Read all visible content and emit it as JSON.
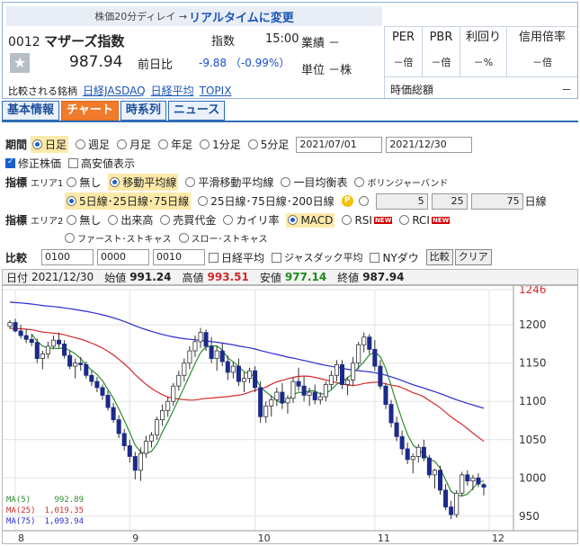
{
  "header": {
    "delay_text": "株価20分ディレイ →",
    "realtime_link": "リアルタイムに変更",
    "code": "0012",
    "name": "マザーズ指数",
    "kind": "指数",
    "time": "15:00",
    "price": "987.94",
    "prev_label": "前日比",
    "change": "-9.88 （-0.99%）",
    "compare_label": "比較される銘柄",
    "compare_links": [
      "日経JASDAQ",
      "日経平均",
      "TOPIX"
    ],
    "industry": "業績 －",
    "unit": "単位 －株",
    "metrics": [
      {
        "label": "PER",
        "value": "－倍"
      },
      {
        "label": "PBR",
        "value": "－倍"
      },
      {
        "label": "利回り",
        "value": "－%"
      },
      {
        "label": "信用倍率",
        "value": "－倍"
      }
    ],
    "market_cap_label": "時価総額",
    "market_cap_value": "－"
  },
  "tabs": [
    "基本情報",
    "チャート",
    "時系列",
    "ニュース"
  ],
  "controls": {
    "period_label": "期間",
    "period_options": [
      "日足",
      "週足",
      "月足",
      "年足",
      "1分足",
      "5分足"
    ],
    "date_from": "2021/07/01",
    "date_to": "2021/12/30",
    "adjusted_label": "修正株価",
    "highlow_label": "高安値表示",
    "indicator_label": "指標",
    "area1_label": "エリア1",
    "area1_options": [
      "無し",
      "移動平均線",
      "平滑移動平均線",
      "一目均衡表",
      "ボリンジャーバンド"
    ],
    "ma_option_a": "5日線･25日線･75日線",
    "ma_option_b": "25日線･75日線･200日線",
    "p_mark": "P",
    "ma_custom": [
      "5",
      "25",
      "75"
    ],
    "day_unit": "日線",
    "area2_label": "エリア2",
    "area2_options": [
      "無し",
      "出来高",
      "売買代金",
      "カイリ率",
      "MACD",
      "RSI",
      "RCI"
    ],
    "new_badge": "NEW",
    "area2_options_b": [
      "ファースト･ストキャス",
      "スロー･ストキャス"
    ],
    "compare_label": "比較",
    "compare_codes": [
      "0100",
      "0000",
      "0010"
    ],
    "compare_checks": [
      "日経平均",
      "ジャスダック平均",
      "NYダウ"
    ],
    "compare_button": "比較",
    "clear_button": "クリア"
  },
  "chart_info": {
    "date_label": "日付",
    "date": "2021/12/30",
    "open_label": "始値",
    "open": "991.24",
    "high_label": "高値",
    "high": "993.51",
    "low_label": "安値",
    "low": "977.14",
    "close_label": "終値",
    "close": "987.94"
  },
  "ma_legend": [
    {
      "label": "MA(5)",
      "value": "992.89",
      "color": "#2e8b2e"
    },
    {
      "label": "MA(25)",
      "value": "1,019.35",
      "color": "#d42a2a"
    },
    {
      "label": "MA(75)",
      "value": "1,093.94",
      "color": "#2a2ad4"
    }
  ],
  "chart_data": {
    "type": "candlestick",
    "y_ticks": [
      1246,
      1200,
      1150,
      1100,
      1050,
      1000,
      950
    ],
    "ylim": [
      931,
      1246
    ],
    "x_ticks": [
      "8",
      "9",
      "10",
      "11",
      "12"
    ],
    "candles": [
      [
        1198,
        1206,
        1195,
        1203
      ],
      [
        1203,
        1208,
        1190,
        1192
      ],
      [
        1192,
        1200,
        1182,
        1186
      ],
      [
        1186,
        1195,
        1176,
        1181
      ],
      [
        1181,
        1188,
        1172,
        1177
      ],
      [
        1177,
        1182,
        1150,
        1156
      ],
      [
        1156,
        1166,
        1142,
        1162
      ],
      [
        1162,
        1178,
        1156,
        1172
      ],
      [
        1172,
        1186,
        1168,
        1180
      ],
      [
        1180,
        1190,
        1170,
        1175
      ],
      [
        1175,
        1180,
        1156,
        1160
      ],
      [
        1160,
        1166,
        1142,
        1146
      ],
      [
        1146,
        1156,
        1130,
        1150
      ],
      [
        1150,
        1158,
        1140,
        1148
      ],
      [
        1148,
        1152,
        1130,
        1134
      ],
      [
        1134,
        1140,
        1120,
        1126
      ],
      [
        1126,
        1132,
        1112,
        1118
      ],
      [
        1118,
        1122,
        1102,
        1108
      ],
      [
        1108,
        1114,
        1088,
        1092
      ],
      [
        1092,
        1098,
        1072,
        1076
      ],
      [
        1076,
        1082,
        1052,
        1058
      ],
      [
        1058,
        1064,
        1036,
        1042
      ],
      [
        1042,
        1050,
        1020,
        1028
      ],
      [
        1028,
        1034,
        998,
        1010
      ],
      [
        1010,
        1040,
        996,
        1032
      ],
      [
        1032,
        1055,
        1026,
        1048
      ],
      [
        1048,
        1060,
        1040,
        1056
      ],
      [
        1056,
        1080,
        1050,
        1076
      ],
      [
        1076,
        1096,
        1068,
        1088
      ],
      [
        1088,
        1106,
        1080,
        1100
      ],
      [
        1100,
        1124,
        1094,
        1120
      ],
      [
        1120,
        1140,
        1114,
        1134
      ],
      [
        1134,
        1156,
        1126,
        1150
      ],
      [
        1150,
        1172,
        1142,
        1166
      ],
      [
        1166,
        1186,
        1158,
        1178
      ],
      [
        1178,
        1196,
        1170,
        1190
      ],
      [
        1190,
        1194,
        1166,
        1172
      ],
      [
        1172,
        1184,
        1150,
        1156
      ],
      [
        1156,
        1172,
        1140,
        1166
      ],
      [
        1166,
        1176,
        1146,
        1152
      ],
      [
        1152,
        1160,
        1128,
        1138
      ],
      [
        1138,
        1152,
        1130,
        1146
      ],
      [
        1146,
        1156,
        1120,
        1126
      ],
      [
        1126,
        1138,
        1112,
        1130
      ],
      [
        1130,
        1144,
        1124,
        1140
      ],
      [
        1140,
        1146,
        1112,
        1118
      ],
      [
        1118,
        1126,
        1072,
        1080
      ],
      [
        1080,
        1100,
        1072,
        1094
      ],
      [
        1094,
        1108,
        1080,
        1102
      ],
      [
        1102,
        1118,
        1094,
        1112
      ],
      [
        1112,
        1124,
        1090,
        1098
      ],
      [
        1098,
        1108,
        1084,
        1104
      ],
      [
        1104,
        1132,
        1098,
        1126
      ],
      [
        1126,
        1144,
        1114,
        1120
      ],
      [
        1120,
        1132,
        1100,
        1108
      ],
      [
        1108,
        1118,
        1094,
        1112
      ],
      [
        1112,
        1122,
        1096,
        1102
      ],
      [
        1102,
        1112,
        1096,
        1106
      ],
      [
        1106,
        1126,
        1100,
        1122
      ],
      [
        1122,
        1140,
        1116,
        1134
      ],
      [
        1134,
        1154,
        1126,
        1148
      ],
      [
        1148,
        1154,
        1116,
        1122
      ],
      [
        1122,
        1132,
        1108,
        1128
      ],
      [
        1128,
        1158,
        1120,
        1150
      ],
      [
        1150,
        1178,
        1142,
        1174
      ],
      [
        1174,
        1190,
        1164,
        1184
      ],
      [
        1184,
        1188,
        1162,
        1168
      ],
      [
        1168,
        1180,
        1140,
        1146
      ],
      [
        1146,
        1154,
        1116,
        1120
      ],
      [
        1120,
        1124,
        1090,
        1096
      ],
      [
        1096,
        1102,
        1066,
        1072
      ],
      [
        1072,
        1080,
        1048,
        1054
      ],
      [
        1054,
        1062,
        1030,
        1038
      ],
      [
        1038,
        1046,
        1018,
        1024
      ],
      [
        1024,
        1032,
        1006,
        1028
      ],
      [
        1028,
        1044,
        1020,
        1040
      ],
      [
        1040,
        1050,
        1022,
        1026
      ],
      [
        1026,
        1030,
        1000,
        1004
      ],
      [
        1004,
        1012,
        986,
        1010
      ],
      [
        1010,
        1016,
        978,
        984
      ],
      [
        984,
        992,
        958,
        962
      ],
      [
        962,
        970,
        946,
        952
      ],
      [
        952,
        984,
        948,
        980
      ],
      [
        980,
        1008,
        976,
        1004
      ],
      [
        1004,
        1010,
        990,
        996
      ],
      [
        996,
        1004,
        984,
        1000
      ],
      [
        1000,
        1006,
        988,
        992
      ],
      [
        991.24,
        993.51,
        977.14,
        987.94
      ]
    ]
  }
}
